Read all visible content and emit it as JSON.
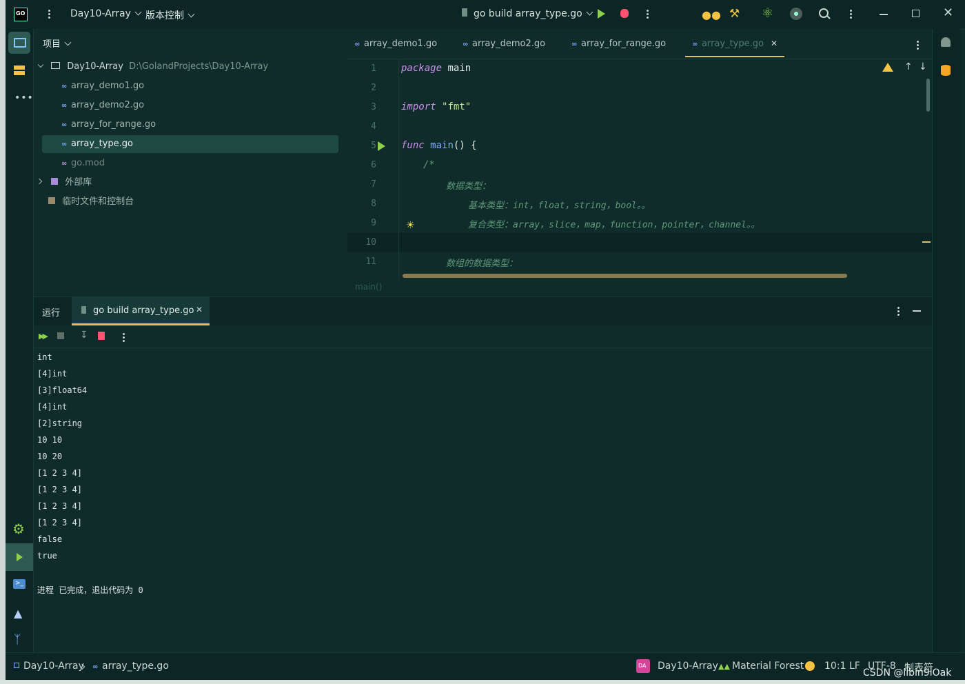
{
  "titlebar": {
    "project_name": "Day10-Array",
    "vcs_label": "版本控制",
    "run_config": "go build array_type.go"
  },
  "project_panel": {
    "title": "项目",
    "root": "Day10-Array",
    "root_path": "D:\\GolandProjects\\Day10-Array",
    "files": [
      "array_demo1.go",
      "array_demo2.go",
      "array_for_range.go",
      "array_type.go",
      "go.mod"
    ],
    "external_libs": "外部库",
    "scratches": "临时文件和控制台"
  },
  "editor": {
    "tabs": [
      "array_demo1.go",
      "array_demo2.go",
      "array_for_range.go",
      "array_type.go"
    ],
    "line_numbers": [
      "1",
      "2",
      "3",
      "4",
      "5",
      "6",
      "7",
      "8",
      "9",
      "10",
      "11"
    ],
    "code": {
      "l1_kw": "package",
      "l1_id": "main",
      "l3_kw": "import",
      "l3_str": "\"fmt\"",
      "l5_kw": "func",
      "l5_fn": "main",
      "l5_rest": "() {",
      "l6": "/*",
      "l7": "数据类型：",
      "l8": "基本类型：int，float，string，bool。。",
      "l9": "复合类型：array，slice，map，function，pointer，channel。。",
      "l11": "数组的数据类型："
    },
    "breadcrumb": "main()"
  },
  "run_panel": {
    "title": "运行",
    "tab_label": "go build array_type.go",
    "output": [
      "int",
      "[4]int",
      "[3]float64",
      "[4]int",
      "[2]string",
      "10 10",
      "10 20",
      "[1 2 3 4]",
      "[1 2 3 4]",
      "[1 2 3 4]",
      "[1 2 3 4]",
      "false",
      "true"
    ],
    "exit_message": "进程 已完成，退出代码为 0"
  },
  "status_bar": {
    "project": "Day10-Array",
    "file": "array_type.go",
    "avatar": "DA",
    "project_label": "Day10-Array",
    "theme": "Material Forest",
    "position": "10:1",
    "line_sep": "LF",
    "encoding": "UTF-8",
    "indent": "制表符",
    "watermark": "CSDN @libin9iOak"
  },
  "colors": {
    "background": "#0f2b2a",
    "accent": "#e4c25c",
    "keyword": "#c792ea",
    "string": "#c3e88d",
    "comment": "#5f9a7b",
    "run_green": "#8fd14f",
    "stop_red": "#ff5370"
  }
}
